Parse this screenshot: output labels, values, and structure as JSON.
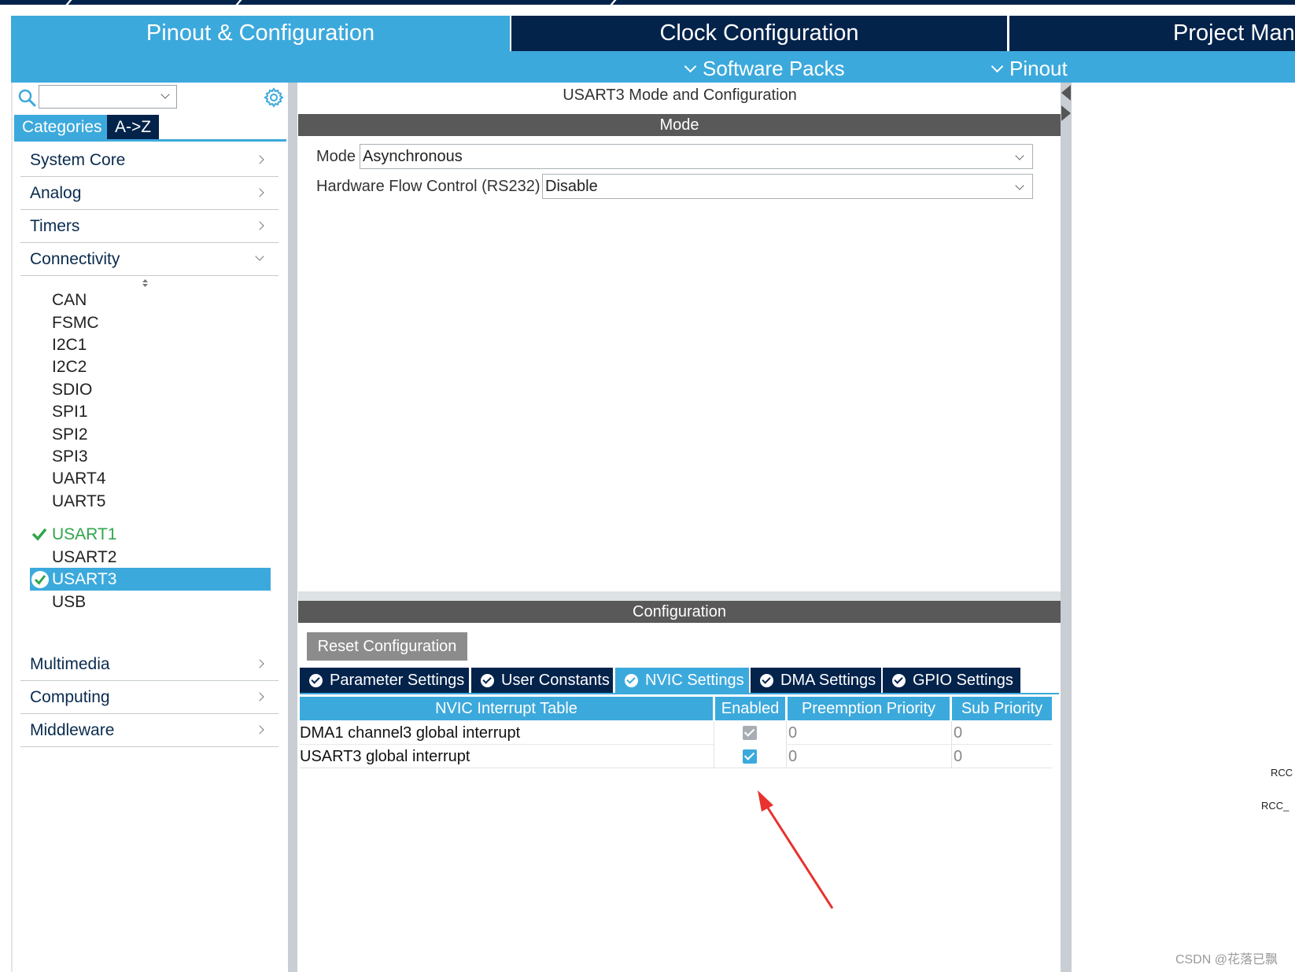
{
  "main_tabs": {
    "pinout": "Pinout & Configuration",
    "clock": "Clock Configuration",
    "project": "Project Man"
  },
  "sub_menu": {
    "software_packs": "Software Packs",
    "pinout": "Pinout"
  },
  "left": {
    "view_tabs": {
      "categories": "Categories",
      "az": "A->Z"
    },
    "categories": {
      "system_core": "System Core",
      "analog": "Analog",
      "timers": "Timers",
      "connectivity": "Connectivity",
      "multimedia": "Multimedia",
      "computing": "Computing",
      "middleware": "Middleware"
    },
    "connectivity_items": [
      "CAN",
      "FSMC",
      "I2C1",
      "I2C2",
      "SDIO",
      "SPI1",
      "SPI2",
      "SPI3",
      "UART4",
      "UART5",
      "USART1",
      "USART2",
      "USART3",
      "USB"
    ]
  },
  "panel": {
    "title": "USART3 Mode and Configuration",
    "mode_header": "Mode",
    "mode_label": "Mode",
    "mode_value": "Asynchronous",
    "hw_flow_label": "Hardware Flow Control (RS232)",
    "hw_flow_value": "Disable",
    "config_header": "Configuration",
    "reset_button": "Reset Configuration",
    "config_tabs": {
      "parameter": "Parameter Settings",
      "user_constants": "User Constants",
      "nvic": "NVIC Settings",
      "dma": "DMA Settings",
      "gpio": "GPIO Settings"
    },
    "nvic_table": {
      "headers": [
        "NVIC Interrupt Table",
        "Enabled",
        "Preemption Priority",
        "Sub Priority"
      ],
      "rows": [
        {
          "name": "DMA1 channel3 global interrupt",
          "enabled": true,
          "enabled_locked": true,
          "preemption": "0",
          "sub": "0"
        },
        {
          "name": "USART3 global interrupt",
          "enabled": true,
          "enabled_locked": false,
          "preemption": "0",
          "sub": "0"
        }
      ]
    }
  },
  "right_labels": [
    "RCC",
    "RCC_"
  ],
  "watermark": "CSDN @花落已飘",
  "colors": {
    "accent": "#3ca9dc",
    "navy": "#03234b",
    "ok_green": "#2fa64a",
    "arrow_red": "#e8322f"
  }
}
